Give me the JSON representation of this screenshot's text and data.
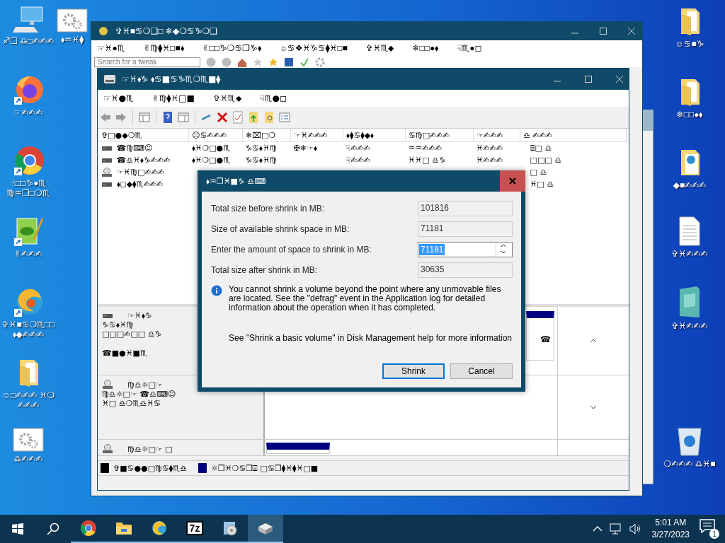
{
  "desktop_icons": [
    {
      "kind": "pc",
      "label": "♐☐ ♎□✍✍✍"
    },
    {
      "kind": "settings",
      "label": "⬧♒♓⧫"
    },
    {
      "kind": "firefox",
      "label": "☞✍✍✍"
    },
    {
      "kind": "chrome",
      "label": "☝□□♑●♏ ♍♒❒□❍♏"
    },
    {
      "kind": "notepad",
      "label": "✌✍✍✍"
    },
    {
      "kind": "edge",
      "label": "✞♓■♋❍♏□□ ⬧◆✍✍✍"
    },
    {
      "kind": "folder",
      "label": "☺□✍✍✍ ♓❍✍✍✍"
    },
    {
      "kind": "settings",
      "label": "♎✍✍✍"
    },
    {
      "kind": "folder",
      "label": "☺♋■♑"
    },
    {
      "kind": "folder",
      "label": "❄□□●⬧"
    },
    {
      "kind": "webfolder",
      "label": "◆■✍✍✍"
    },
    {
      "kind": "text",
      "label": "✞♓✍✍✍"
    },
    {
      "kind": "app",
      "label": "✞♓✍✍✍"
    },
    {
      "kind": "recycle",
      "label": "❍✍✍✍ ♎♓■"
    }
  ],
  "back_window": {
    "title": "✞♓■♋❍❑□ ❄◆❍♋♑❍❑",
    "menu": [
      "☞♓●♏",
      "✌♍⧫♓□■⬧",
      "✌□□♑❍♋❒♑⬧",
      "☼♋❖♓♑♋⧫♓□■",
      "✞♓♏⬥",
      "❄□□●⬧",
      "☟♏●◻"
    ],
    "search": {
      "placeholder": "Search for a tweak"
    }
  },
  "window": {
    "title": "☞♓⬧♑ ⬧♋■♋♑♏❍♏■⧫",
    "menu": [
      "☞♓●♏",
      "✌♍⧫♓□■",
      "✞♓♏⬥",
      "☟♏●◻"
    ],
    "columns": [
      "✞□●◆❍♏",
      "☹♋✍✍✍",
      "❄⌧□❍",
      "☞♓✍✍✍",
      "⬧⧫♋⧫◆⬧",
      "♋♍□✍✍✍",
      "☞✍✍✍",
      "♎ ✍✍✍"
    ],
    "rows": [
      {
        "kind": "disk",
        "cells": [
          "☎♍⌨☺",
          "⬧♓❍□●♏",
          "♑♋⬧♓♍",
          "✠❄☞⬧",
          "☟✍✍✍",
          "♒♒✍✍✍",
          "♓✍✍✍",
          "⌸□ ♎"
        ]
      },
      {
        "kind": "disk",
        "cells": [
          "☎♎♓⬧♑✍✍✍",
          "⬧♓❍□●♏",
          "♑♋⬧♓♍",
          null,
          "☟✍✍✍",
          "♓♓□ ♎♑",
          "♓✍✍✍",
          "□□□ ♎"
        ]
      },
      {
        "kind": "cd",
        "cells": [
          "☞♓♍□✍✍✍",
          null,
          null,
          null,
          null,
          null,
          null,
          "□ ♎"
        ]
      },
      {
        "kind": "disk",
        "cells": [
          "⬧◻◆⧫♏✍✍✍",
          null,
          null,
          null,
          null,
          null,
          null,
          "♓□ ♎"
        ]
      }
    ],
    "disks": [
      {
        "kind": "disk",
        "lines": [
          "☞♓⬧♑",
          "♑♋⬧♓♍",
          "□□□✍□□ ♎♑",
          "☎■●♓■♏"
        ],
        "partition": "☎"
      },
      {
        "kind": "cd",
        "lines": [
          "♍♎☼□☞",
          "♍♎☼□☞ ☎♎⌨☺",
          "♓□ ♎❍♏♎♓♋"
        ]
      },
      {
        "kind": "cd",
        "lines": [
          "♍♎☼□☞ □"
        ]
      }
    ],
    "legend": [
      {
        "label": "✞■♋●●□♍♋⧫♏♎",
        "color": "#000000"
      },
      {
        "label": "☼❒♓❍♋❒⍓ □♋❒⧫♓⧫♓□■",
        "color": "#000080"
      }
    ]
  },
  "dialog": {
    "title": "⬧♒❒♓■♑ ♎⌨",
    "fields": [
      {
        "kind": "readonly",
        "label": "Total size before shrink in MB:",
        "value": "101816"
      },
      {
        "kind": "readonly",
        "label": "Size of available shrink space in MB:",
        "value": "71181"
      },
      {
        "kind": "spin",
        "label": "Enter the amount of space to shrink in MB:",
        "value": "71181",
        "text_selected": true
      },
      {
        "kind": "readonly",
        "label": "Total size after shrink in MB:",
        "value": "30635"
      }
    ],
    "info": "You cannot shrink a volume beyond the point where any unmovable files are located. See the \"defrag\" event in the Application log for detailed information about the operation when it has completed.",
    "help": "See \"Shrink a basic volume\" in Disk Management help for more information",
    "buttons": [
      {
        "label": "Shrink",
        "default": true
      },
      {
        "label": "Cancel",
        "default": false
      }
    ]
  },
  "taskbar": {
    "apps": [
      {
        "kind": "chrome",
        "selected": false
      },
      {
        "kind": "folder",
        "selected": false
      },
      {
        "kind": "edge",
        "selected": false
      },
      {
        "kind": "archive",
        "label": "7z",
        "selected": false
      },
      {
        "kind": "installer",
        "selected": false
      },
      {
        "kind": "diskmgmt",
        "selected": true
      }
    ],
    "time": "5:01 AM",
    "date": "3/27/2023",
    "notifications": "1"
  }
}
